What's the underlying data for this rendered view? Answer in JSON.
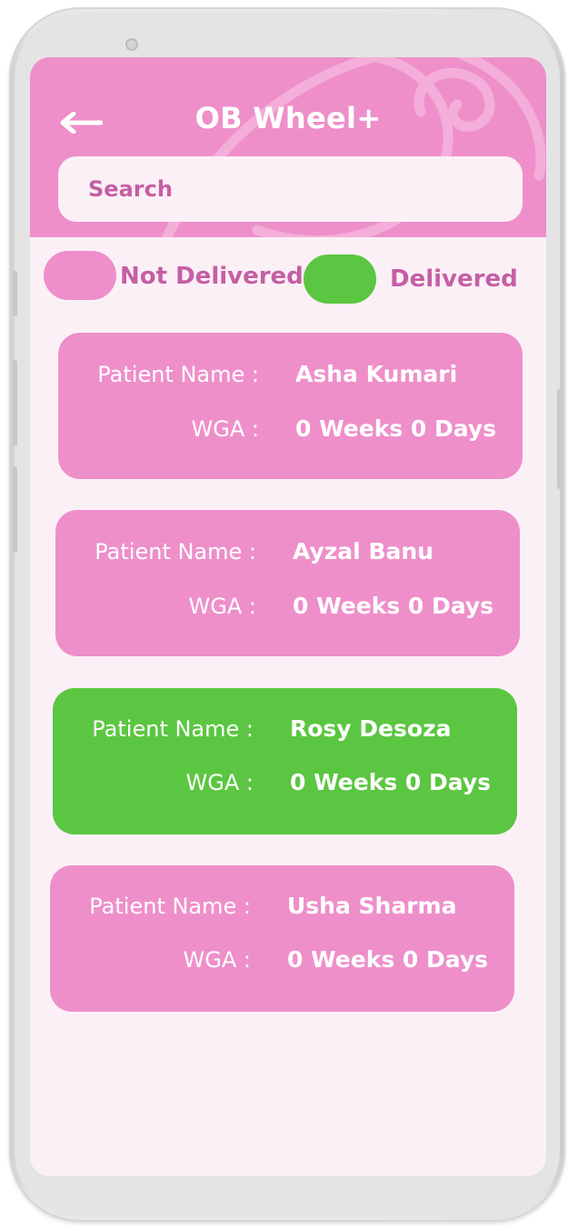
{
  "app": {
    "title": "OB Wheel+",
    "back_icon": "arrow-left-icon"
  },
  "search": {
    "placeholder": "Search",
    "value": ""
  },
  "legend": {
    "not_delivered": {
      "label": "Not Delivered",
      "color": "#ee8fca"
    },
    "delivered": {
      "label": "Delivered",
      "color": "#5bc641"
    }
  },
  "patients": [
    {
      "name_label": "Patient Name :",
      "name": "Asha Kumari",
      "wga_label": "WGA :",
      "wga": "0 Weeks 0 Days",
      "status": "not_delivered"
    },
    {
      "name_label": "Patient Name :",
      "name": "Ayzal Banu",
      "wga_label": "WGA :",
      "wga": "0 Weeks 0 Days",
      "status": "not_delivered"
    },
    {
      "name_label": "Patient Name :",
      "name": "Rosy Desoza",
      "wga_label": "WGA :",
      "wga": "0 Weeks 0 Days",
      "status": "delivered"
    },
    {
      "name_label": "Patient Name :",
      "name": "Usha Sharma",
      "wga_label": "WGA :",
      "wga": "0 Weeks 0 Days",
      "status": "not_delivered"
    }
  ]
}
